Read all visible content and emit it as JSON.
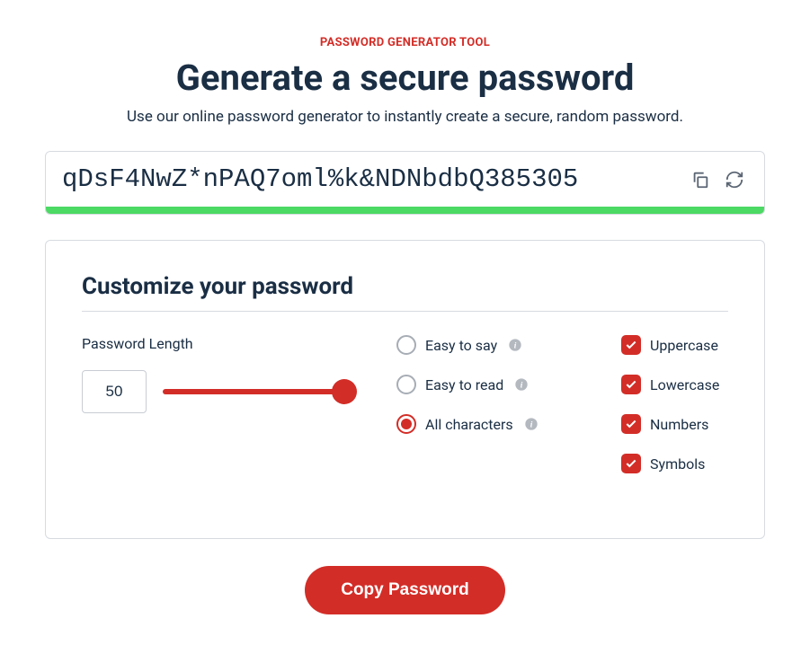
{
  "header": {
    "eyebrow": "PASSWORD GENERATOR TOOL",
    "title": "Generate a secure password",
    "subtitle": "Use our online password generator to instantly create a secure, random password."
  },
  "password": {
    "value": "qDsF4NwZ*nPAQ7oml%k&NDNbdbQ385305"
  },
  "customize": {
    "title": "Customize your password",
    "length_label": "Password Length",
    "length_value": "50",
    "radio_options": {
      "easy_say": "Easy to say",
      "easy_read": "Easy to read",
      "all_chars": "All characters"
    },
    "checkbox_options": {
      "uppercase": "Uppercase",
      "lowercase": "Lowercase",
      "numbers": "Numbers",
      "symbols": "Symbols"
    }
  },
  "actions": {
    "copy_button": "Copy Password"
  }
}
